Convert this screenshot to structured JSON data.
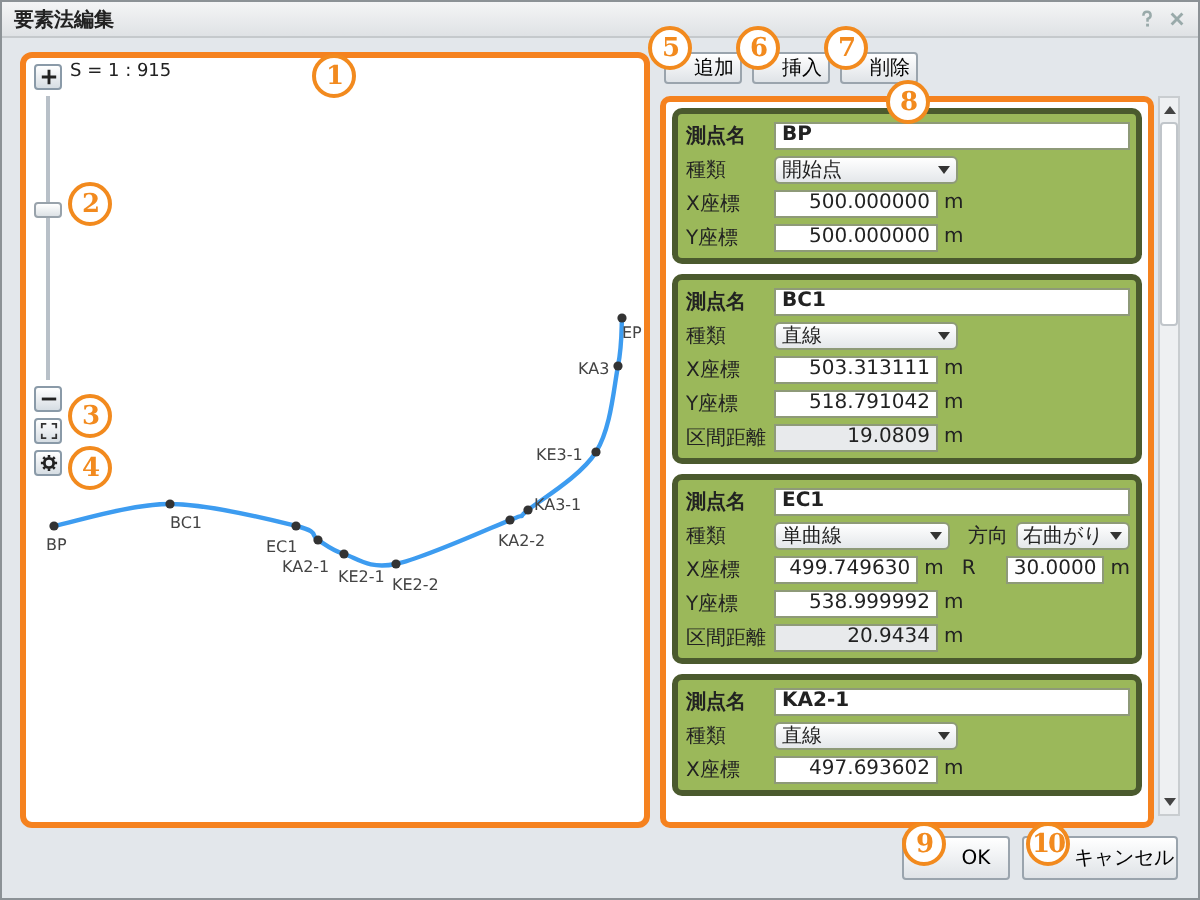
{
  "window": {
    "title": "要素法編集"
  },
  "map": {
    "scale": "S = 1 : 915",
    "zoom": {
      "level": 0.6
    },
    "points": [
      {
        "label": "EP"
      },
      {
        "label": "KA3"
      },
      {
        "label": "KE3-1"
      },
      {
        "label": "KA3-1"
      },
      {
        "label": "BC1"
      },
      {
        "label": "BP"
      },
      {
        "label": "EC1"
      },
      {
        "label": "KA2-2"
      },
      {
        "label": "KA2-1"
      },
      {
        "label": "KE2-1"
      },
      {
        "label": "KE2-2"
      }
    ]
  },
  "toolbar": [
    "追加",
    "挿入",
    "削除"
  ],
  "cards": [
    {
      "name_label": "測点名",
      "name": "BP",
      "rows": [
        {
          "label": "種類",
          "kind": "select",
          "value": "開始点"
        },
        {
          "label": "X座標",
          "kind": "input",
          "value": "500.000000",
          "unit": "m"
        },
        {
          "label": "Y座標",
          "kind": "input",
          "value": "500.000000",
          "unit": "m"
        }
      ]
    },
    {
      "name_label": "測点名",
      "name": "BC1",
      "rows": [
        {
          "label": "種類",
          "kind": "select",
          "value": "直線"
        },
        {
          "label": "X座標",
          "kind": "input",
          "value": "503.313111",
          "unit": "m"
        },
        {
          "label": "Y座標",
          "kind": "input",
          "value": "518.791042",
          "unit": "m"
        },
        {
          "label": "区間距離",
          "kind": "readonly",
          "value": "19.0809",
          "unit": "m"
        }
      ]
    },
    {
      "name_label": "測点名",
      "name": "EC1",
      "rows": [
        {
          "label": "種類",
          "kind": "select",
          "value": "単曲線",
          "extra": {
            "label": "方向",
            "kind": "select",
            "value": "右曲がり"
          }
        },
        {
          "label": "X座標",
          "kind": "input",
          "value": "499.749630",
          "unit": "m",
          "extra": {
            "label": "R",
            "kind": "input",
            "value": "30.0000",
            "unit": "m"
          }
        },
        {
          "label": "Y座標",
          "kind": "input",
          "value": "538.999992",
          "unit": "m"
        },
        {
          "label": "区間距離",
          "kind": "readonly",
          "value": "20.9434",
          "unit": "m"
        }
      ]
    },
    {
      "name_label": "測点名",
      "name": "KA2-1",
      "rows": [
        {
          "label": "種類",
          "kind": "select",
          "value": "直線"
        },
        {
          "label": "X座標",
          "kind": "input",
          "value": "497.693602",
          "unit": "m"
        }
      ]
    }
  ],
  "buttons": [
    "OK",
    "キャンセル"
  ],
  "callouts": [
    "1",
    "2",
    "3",
    "4",
    "5",
    "6",
    "7",
    "8",
    "9",
    "10"
  ]
}
